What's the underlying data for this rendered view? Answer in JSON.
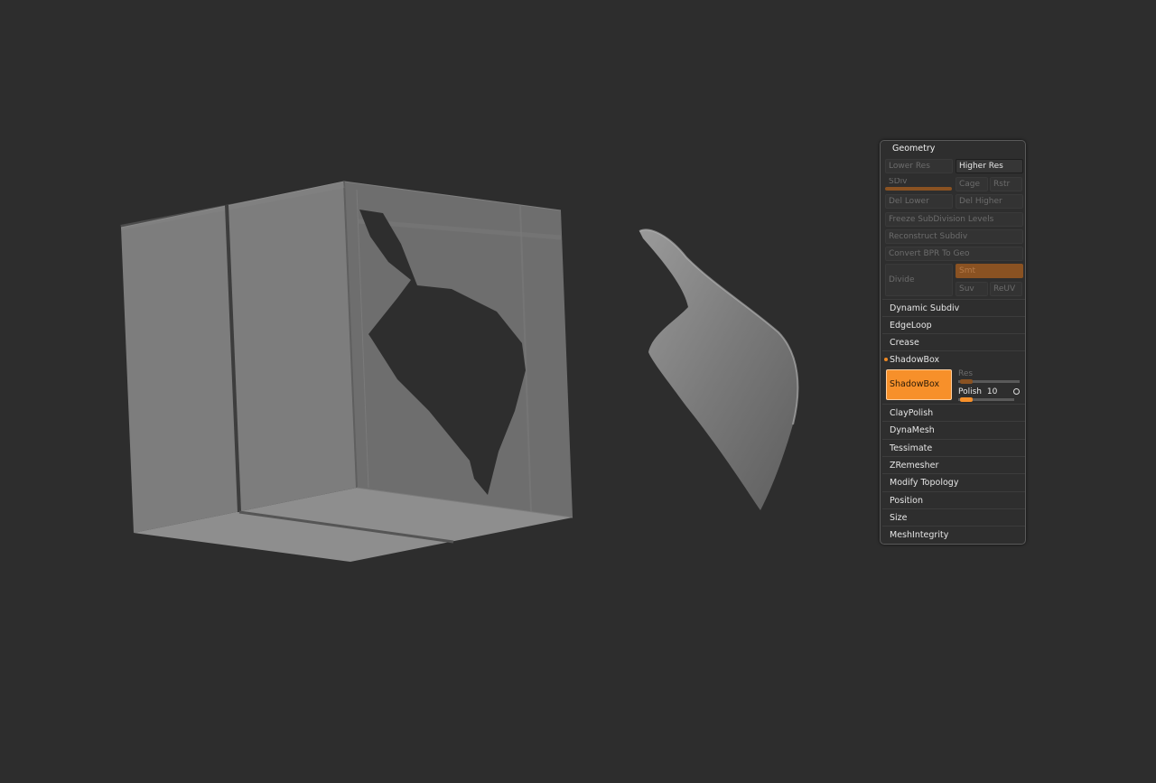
{
  "geometry_panel": {
    "title": "Geometry",
    "lower_res": "Lower Res",
    "higher_res": "Higher Res",
    "sdiv": "SDiv",
    "cage": "Cage",
    "rstr": "Rstr",
    "del_lower": "Del Lower",
    "del_higher": "Del Higher",
    "freeze_subdivision_levels": "Freeze SubDivision Levels",
    "reconstruct_subdiv": "Reconstruct Subdiv",
    "convert_bpr_to_geo": "Convert BPR To Geo",
    "divide": "Divide",
    "smt": "Smt",
    "suv": "Suv",
    "reuv": "ReUV",
    "subpalettes": {
      "dynamic_subdiv": "Dynamic Subdiv",
      "edgeloop": "EdgeLoop",
      "crease": "Crease",
      "shadowbox": "ShadowBox"
    },
    "shadowbox_section": {
      "button_label": "ShadowBox",
      "res_label": "Res",
      "polish_label": "Polish",
      "polish_value": "10"
    },
    "subpalettes_after": {
      "claypolish": "ClayPolish",
      "dynamesh": "DynaMesh",
      "tessimate": "Tessimate",
      "zremesher": "ZRemesher",
      "modify_topology": "Modify Topology",
      "position": "Position",
      "size": "Size",
      "meshintegrity": "MeshIntegrity"
    }
  },
  "colors": {
    "background": "#2d2d2d",
    "accent_orange": "#f7902a",
    "dim_orange": "#8a5222"
  }
}
